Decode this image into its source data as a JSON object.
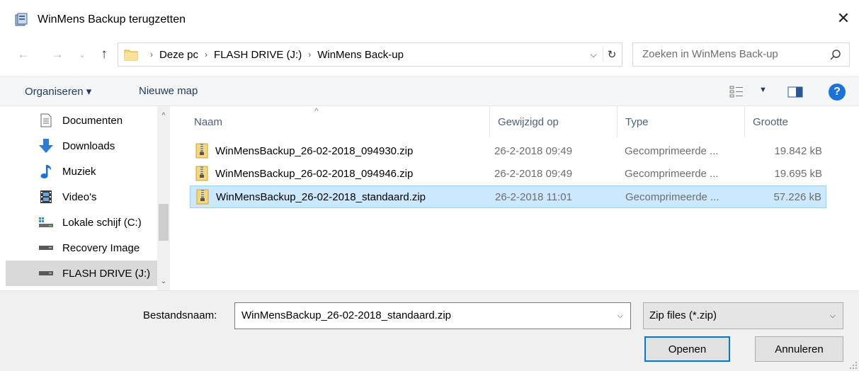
{
  "window": {
    "title": "WinMens Backup terugzetten",
    "close_glyph": "✕"
  },
  "nav": {
    "back_glyph": "←",
    "forward_glyph": "→",
    "recent_glyph": "⌄",
    "up_glyph": "↑",
    "breadcrumbs": [
      "Deze pc",
      "FLASH DRIVE (J:)",
      "WinMens Back-up"
    ],
    "crumb_separator": "›",
    "dropdown_glyph": "⌵",
    "refresh_glyph": "↻"
  },
  "search": {
    "placeholder": "Zoeken in WinMens Back-up"
  },
  "toolbar": {
    "organise_label": "Organiseren ▾",
    "new_folder_label": "Nieuwe map",
    "view_arrow": "▼",
    "help_label": "?"
  },
  "sidebar": {
    "items": [
      {
        "label": "Documenten",
        "icon": "document-icon"
      },
      {
        "label": "Downloads",
        "icon": "download-arrow-icon"
      },
      {
        "label": "Muziek",
        "icon": "music-note-icon"
      },
      {
        "label": "Video's",
        "icon": "film-icon"
      },
      {
        "label": "Lokale schijf (C:)",
        "icon": "windows-drive-icon"
      },
      {
        "label": "Recovery Image",
        "icon": "drive-icon"
      },
      {
        "label": "FLASH DRIVE (J:)",
        "icon": "drive-icon",
        "selected": true
      }
    ],
    "scroll_up_glyph": "^",
    "scroll_down_glyph": "⌄"
  },
  "filelist": {
    "columns": [
      "Naam",
      "Gewijzigd op",
      "Type",
      "Grootte"
    ],
    "sort_glyph": "^",
    "files": [
      {
        "name": "WinMensBackup_26-02-2018_094930.zip",
        "date": "26-2-2018 09:49",
        "type": "Gecomprimeerde ...",
        "size": "19.842 kB",
        "selected": false
      },
      {
        "name": "WinMensBackup_26-02-2018_094946.zip",
        "date": "26-2-2018 09:49",
        "type": "Gecomprimeerde ...",
        "size": "19.695 kB",
        "selected": false
      },
      {
        "name": "WinMensBackup_26-02-2018_standaard.zip",
        "date": "26-2-2018 11:01",
        "type": "Gecomprimeerde ...",
        "size": "57.226 kB",
        "selected": true
      }
    ]
  },
  "bottom": {
    "filename_label": "Bestandsnaam:",
    "filename_value": "WinMensBackup_26-02-2018_standaard.zip",
    "filter_value": "Zip files (*.zip)",
    "dropdown_glyph": "⌵",
    "open_label": "Openen",
    "cancel_label": "Annuleren"
  },
  "colors": {
    "selection_bg": "#cce8ff",
    "selection_border": "#99d1ff",
    "accent": "#0078d7",
    "help_blue": "#1a73d9",
    "folder_yellow": "#f8d775"
  }
}
